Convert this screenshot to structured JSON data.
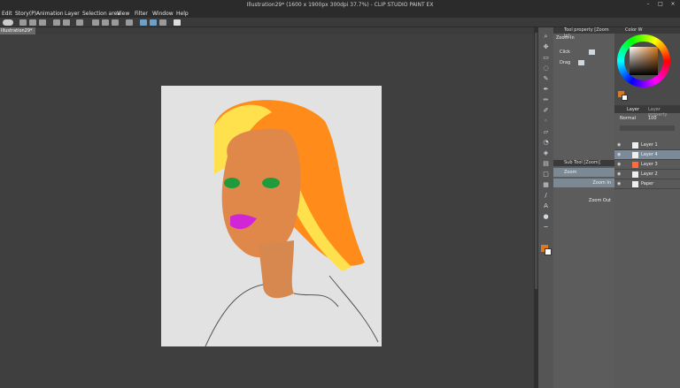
{
  "window": {
    "title": "Illustration29* (1600 x 1900px 300dpi 37.7%)  - CLIP STUDIO PAINT EX",
    "buttons": [
      "–",
      "□",
      "×"
    ]
  },
  "menu": {
    "items": [
      "Edit",
      "Story(P)",
      "Animation",
      "Layer",
      "Selection area",
      "View",
      "Filter",
      "Window",
      "Help"
    ]
  },
  "doc_tab": {
    "label": "Illustration29*"
  },
  "sub_tool": {
    "tool_property_header": "Tool property [Zoom In]",
    "zoom_in_label": "Zoom In",
    "click_label": "Click",
    "drag_label": "Drag",
    "sub_tool_header": "Sub Tool [Zoom]",
    "rows": [
      "Zoom",
      "Zoom In",
      "Zoom Out"
    ]
  },
  "color": {
    "header": "Color W",
    "main": "#d97a1e",
    "sub": "#ffffff"
  },
  "layers": {
    "tabs": [
      "Layer",
      "Layer property"
    ],
    "blend_mode": "Normal",
    "opacity_label": "100",
    "items": [
      {
        "name": "Layer 1"
      },
      {
        "name": "Layer 4"
      },
      {
        "name": "Layer 3"
      },
      {
        "name": "Layer 2"
      },
      {
        "name": "Paper"
      }
    ]
  }
}
